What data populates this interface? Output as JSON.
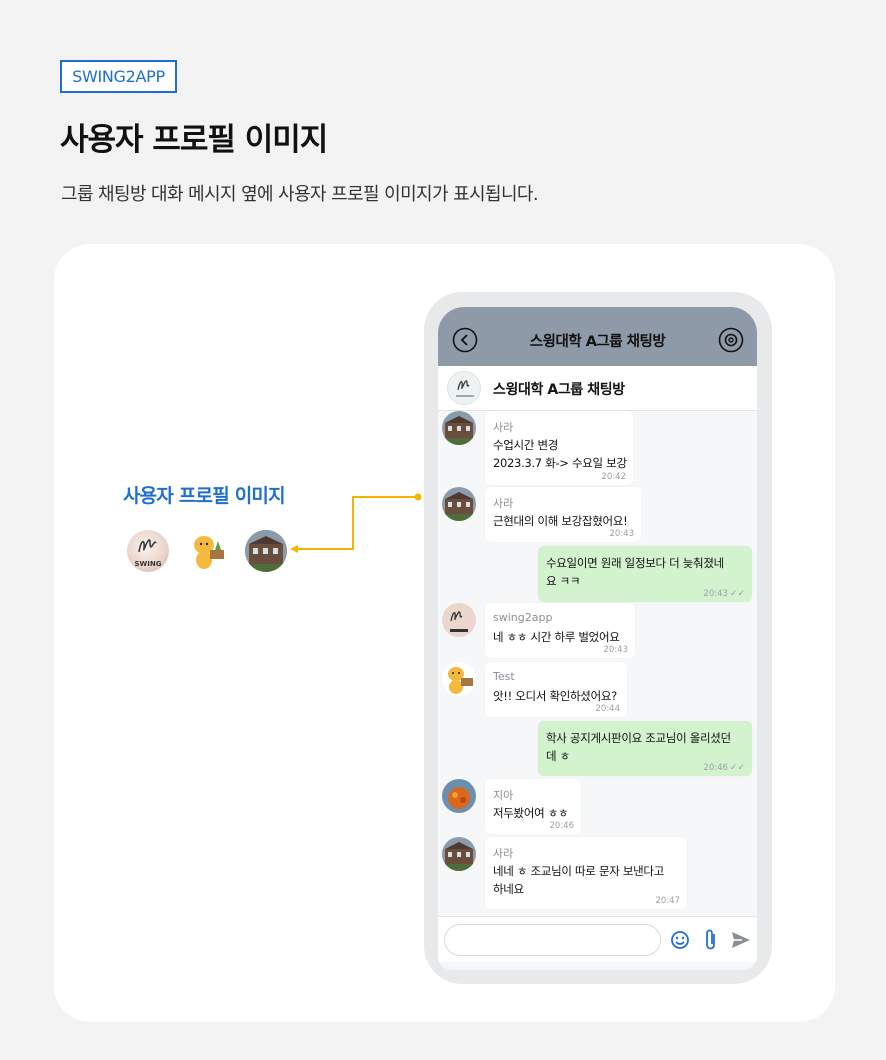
{
  "brand_badge": "SWING2APP",
  "page_title": "사용자 프로필 이미지",
  "description": "그룹 채팅방 대화 메시지 옆에 사용자 프로필 이미지가 표시됩니다.",
  "callout_label": "사용자 프로필 이미지",
  "callout_avatars": [
    "swing-logo-avatar",
    "lion-character-avatar",
    "building-photo-avatar"
  ],
  "logo_text": "SWING",
  "colors": {
    "accent": "#1f6fd1",
    "connector": "#f5b400",
    "topbar": "#8f9aa8",
    "mine_bubble": "#d3f3cf"
  },
  "chat": {
    "title": "스윙대학 A그룹 채팅방",
    "room_name": "스윙대학 A그룹 채팅방",
    "messages": [
      {
        "sender": "사라",
        "lines": "수업시간 변경\n2023.3.7 화-> 수요일 보강",
        "time": "20:42",
        "mine": false
      },
      {
        "sender": "사라",
        "lines": "근현대의 이해 보강잡혔어요!",
        "time": "20:43",
        "mine": false
      },
      {
        "sender": "",
        "lines": "수요일이면 원래 일정보다 더 늦춰졌네\n요 ㅋㅋ",
        "time": "20:43",
        "mine": true
      },
      {
        "sender": "swing2app",
        "lines": "네 ㅎㅎ 시간 하루 벌었어요",
        "time": "20:43",
        "mine": false
      },
      {
        "sender": "Test",
        "lines": "앗!! 오디서 확인하셨어요?",
        "time": "20:44",
        "mine": false
      },
      {
        "sender": "",
        "lines": "학사 공지게시판이요 조교님이 올리셨던\n데 ㅎ",
        "time": "20:46",
        "mine": true
      },
      {
        "sender": "지아",
        "lines": "저두봤어여 ㅎㅎ",
        "time": "20:46",
        "mine": false
      },
      {
        "sender": "사라",
        "lines": "네네 ㅎ 조교님이 따로 문자 보낸다고\n하네요",
        "time": "20:47",
        "mine": false
      }
    ],
    "read_check": "✓✓",
    "input_placeholder": "",
    "icons": [
      "back-icon",
      "settings-icon",
      "emoji-icon",
      "attach-icon",
      "send-icon"
    ]
  }
}
